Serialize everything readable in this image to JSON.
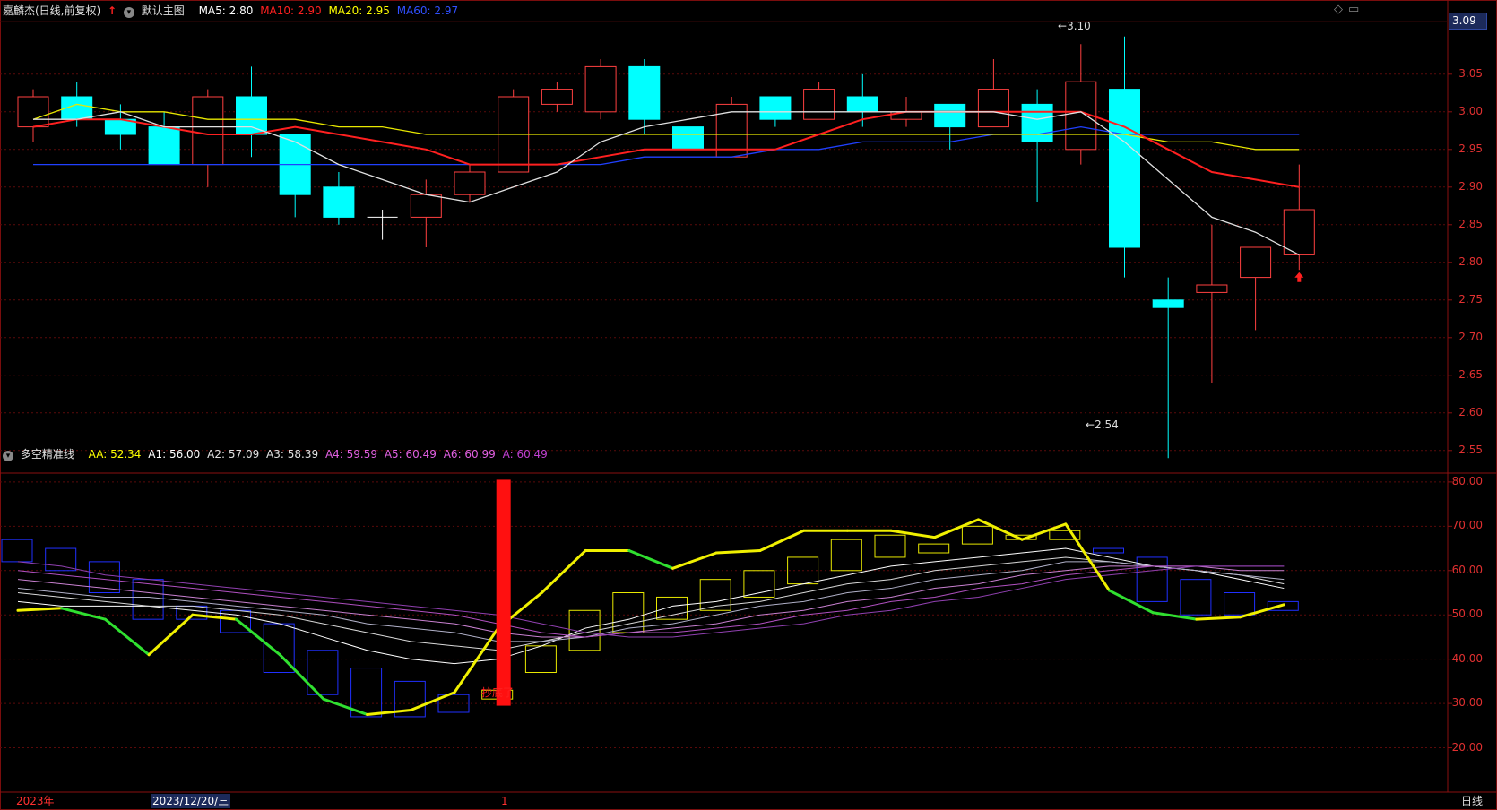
{
  "header_main": {
    "stock": "嘉麟杰(日线,前复权)",
    "up_arrow_icon": "up-arrow-icon",
    "dropdown_icon": "chevron-down-icon",
    "template": "默认主图",
    "ma5": "MA5: 2.80",
    "ma10": "MA10: 2.90",
    "ma20": "MA20: 2.95",
    "ma60": "MA60: 2.97",
    "colors": {
      "ma5": "#ffffff",
      "ma10": "#ff2020",
      "ma20": "#ffff00",
      "ma60": "#3050ff"
    }
  },
  "header_sub": {
    "dropdown_icon": "chevron-down-icon",
    "indicator": "多空精准线",
    "aa": "AA: 52.34",
    "a1": "A1: 56.00",
    "a2": "A2: 57.09",
    "a3": "A3: 58.39",
    "a4": "A4: 59.59",
    "a5": "A5: 60.49",
    "a6": "A6: 60.99",
    "a": "A: 60.49"
  },
  "price_axis": [
    "3.05",
    "3.00",
    "2.95",
    "2.90",
    "2.85",
    "2.80",
    "2.75",
    "2.70",
    "2.65",
    "2.60",
    "2.55"
  ],
  "current_price": "3.09",
  "high_label": "3.10",
  "low_label": "2.54",
  "indicator_axis": [
    "80.00",
    "70.00",
    "60.00",
    "50.00",
    "40.00",
    "30.00",
    "20.00"
  ],
  "signal_label": "抄底了",
  "bottom": {
    "year": "2023年",
    "date": "2023/12/20/三",
    "month_mark": "1",
    "period": "日线"
  },
  "corner_icons": [
    "diamond-icon",
    "window-icon"
  ],
  "chart_data": {
    "type": "candlestick",
    "price_range": [
      2.52,
      3.12
    ],
    "candles": [
      {
        "o": 2.98,
        "c": 3.02,
        "h": 3.03,
        "l": 2.96
      },
      {
        "o": 3.02,
        "c": 2.99,
        "h": 3.04,
        "l": 2.98
      },
      {
        "o": 2.99,
        "c": 2.97,
        "h": 3.01,
        "l": 2.95
      },
      {
        "o": 2.98,
        "c": 2.93,
        "h": 3.0,
        "l": 2.93
      },
      {
        "o": 2.93,
        "c": 3.02,
        "h": 3.03,
        "l": 2.9
      },
      {
        "o": 3.02,
        "c": 2.97,
        "h": 3.06,
        "l": 2.94
      },
      {
        "o": 2.97,
        "c": 2.89,
        "h": 2.97,
        "l": 2.86
      },
      {
        "o": 2.9,
        "c": 2.86,
        "h": 2.92,
        "l": 2.85
      },
      {
        "o": 2.86,
        "c": 2.86,
        "h": 2.87,
        "l": 2.83
      },
      {
        "o": 2.86,
        "c": 2.89,
        "h": 2.91,
        "l": 2.82
      },
      {
        "o": 2.89,
        "c": 2.92,
        "h": 2.93,
        "l": 2.88
      },
      {
        "o": 2.92,
        "c": 3.02,
        "h": 3.03,
        "l": 2.92
      },
      {
        "o": 3.01,
        "c": 3.03,
        "h": 3.04,
        "l": 3.0
      },
      {
        "o": 3.0,
        "c": 3.06,
        "h": 3.07,
        "l": 2.99
      },
      {
        "o": 3.06,
        "c": 2.99,
        "h": 3.07,
        "l": 2.97
      },
      {
        "o": 2.98,
        "c": 2.95,
        "h": 3.02,
        "l": 2.94
      },
      {
        "o": 2.94,
        "c": 3.01,
        "h": 3.02,
        "l": 2.94
      },
      {
        "o": 3.02,
        "c": 2.99,
        "h": 3.02,
        "l": 2.98
      },
      {
        "o": 2.99,
        "c": 3.03,
        "h": 3.04,
        "l": 2.99
      },
      {
        "o": 3.02,
        "c": 3.0,
        "h": 3.05,
        "l": 2.98
      },
      {
        "o": 2.99,
        "c": 3.0,
        "h": 3.02,
        "l": 2.98
      },
      {
        "o": 3.01,
        "c": 2.98,
        "h": 3.01,
        "l": 2.95
      },
      {
        "o": 2.98,
        "c": 3.03,
        "h": 3.07,
        "l": 2.98
      },
      {
        "o": 3.01,
        "c": 2.96,
        "h": 3.03,
        "l": 2.88
      },
      {
        "o": 2.95,
        "c": 3.04,
        "h": 3.09,
        "l": 2.93
      },
      {
        "o": 3.03,
        "c": 2.82,
        "h": 3.1,
        "l": 2.78
      },
      {
        "o": 2.75,
        "c": 2.74,
        "h": 2.78,
        "l": 2.54
      },
      {
        "o": 2.76,
        "c": 2.77,
        "h": 2.85,
        "l": 2.64
      },
      {
        "o": 2.78,
        "c": 2.82,
        "h": 2.82,
        "l": 2.71
      },
      {
        "o": 2.81,
        "c": 2.87,
        "h": 2.93,
        "l": 2.79
      }
    ],
    "ma5": [
      2.99,
      2.99,
      3.0,
      2.98,
      2.98,
      2.98,
      2.96,
      2.93,
      2.91,
      2.89,
      2.88,
      2.9,
      2.92,
      2.96,
      2.98,
      2.99,
      3.0,
      3.0,
      3.0,
      3.0,
      3.0,
      3.0,
      3.0,
      2.99,
      3.0,
      2.96,
      2.91,
      2.86,
      2.84,
      2.81
    ],
    "ma10": [
      2.98,
      2.99,
      2.99,
      2.98,
      2.97,
      2.97,
      2.98,
      2.97,
      2.96,
      2.95,
      2.93,
      2.93,
      2.93,
      2.94,
      2.95,
      2.95,
      2.95,
      2.95,
      2.97,
      2.99,
      3.0,
      3.0,
      3.0,
      3.0,
      3.0,
      2.98,
      2.95,
      2.92,
      2.91,
      2.9
    ],
    "ma20": [
      2.99,
      3.01,
      3.0,
      3.0,
      2.99,
      2.99,
      2.99,
      2.98,
      2.98,
      2.97,
      2.97,
      2.97,
      2.97,
      2.97,
      2.97,
      2.97,
      2.97,
      2.97,
      2.97,
      2.97,
      2.97,
      2.97,
      2.97,
      2.97,
      2.97,
      2.97,
      2.96,
      2.96,
      2.95,
      2.95
    ],
    "ma60": [
      2.93,
      2.93,
      2.93,
      2.93,
      2.93,
      2.93,
      2.93,
      2.93,
      2.93,
      2.93,
      2.93,
      2.93,
      2.93,
      2.93,
      2.94,
      2.94,
      2.94,
      2.95,
      2.95,
      2.96,
      2.96,
      2.96,
      2.97,
      2.97,
      2.98,
      2.97,
      2.97,
      2.97,
      2.97,
      2.97
    ],
    "indicator": {
      "range": [
        10,
        82
      ],
      "aa": [
        51,
        51.5,
        49,
        41,
        50,
        49,
        41,
        31,
        27.5,
        28.5,
        32.5,
        47,
        55,
        64.5,
        64.5,
        60.5,
        64,
        64.5,
        69,
        69,
        69,
        67.5,
        71.5,
        67,
        70.5,
        55.5,
        50.5,
        49,
        49.5,
        52.3
      ],
      "aa_colors": [
        "yellow",
        "yellow",
        "green",
        "green",
        "yellow",
        "yellow",
        "green",
        "green",
        "green",
        "yellow",
        "yellow",
        "yellow",
        "yellow",
        "yellow",
        "yellow",
        "green",
        "yellow",
        "yellow",
        "yellow",
        "yellow",
        "yellow",
        "yellow",
        "yellow",
        "yellow",
        "yellow",
        "yellow",
        "green",
        "green",
        "yellow",
        "yellow"
      ],
      "boxes": [
        {
          "lo": 62,
          "hi": 67,
          "c": "blue"
        },
        {
          "lo": 60,
          "hi": 65,
          "c": "blue"
        },
        {
          "lo": 55,
          "hi": 62,
          "c": "blue"
        },
        {
          "lo": 49,
          "hi": 58,
          "c": "blue"
        },
        {
          "lo": 49,
          "hi": 52,
          "c": "blue"
        },
        {
          "lo": 46,
          "hi": 51,
          "c": "blue"
        },
        {
          "lo": 37,
          "hi": 48,
          "c": "blue"
        },
        {
          "lo": 32,
          "hi": 42,
          "c": "blue"
        },
        {
          "lo": 27,
          "hi": 38,
          "c": "blue"
        },
        {
          "lo": 27,
          "hi": 35,
          "c": "blue"
        },
        {
          "lo": 28,
          "hi": 32,
          "c": "blue"
        },
        {
          "lo": 31,
          "hi": 33,
          "c": "yellow"
        },
        {
          "lo": 37,
          "hi": 43,
          "c": "yellow"
        },
        {
          "lo": 42,
          "hi": 51,
          "c": "yellow"
        },
        {
          "lo": 46,
          "hi": 55,
          "c": "yellow"
        },
        {
          "lo": 49,
          "hi": 54,
          "c": "yellow"
        },
        {
          "lo": 51,
          "hi": 58,
          "c": "yellow"
        },
        {
          "lo": 54,
          "hi": 60,
          "c": "yellow"
        },
        {
          "lo": 57,
          "hi": 63,
          "c": "yellow"
        },
        {
          "lo": 60,
          "hi": 67,
          "c": "yellow"
        },
        {
          "lo": 63,
          "hi": 68,
          "c": "yellow"
        },
        {
          "lo": 64,
          "hi": 66,
          "c": "yellow"
        },
        {
          "lo": 66,
          "hi": 70,
          "c": "yellow"
        },
        {
          "lo": 67,
          "hi": 68,
          "c": "yellow"
        },
        {
          "lo": 67,
          "hi": 69,
          "c": "yellow"
        },
        {
          "lo": 64,
          "hi": 65,
          "c": "blue"
        },
        {
          "lo": 53,
          "hi": 63,
          "c": "blue"
        },
        {
          "lo": 50,
          "hi": 58,
          "c": "blue"
        },
        {
          "lo": 50,
          "hi": 55,
          "c": "blue"
        },
        {
          "lo": 51,
          "hi": 53,
          "c": "blue"
        }
      ],
      "lines": [
        {
          "c": "#ffffff",
          "v": [
            53,
            52,
            52,
            52,
            51,
            50,
            48,
            45,
            42,
            40,
            39,
            40,
            43,
            47,
            49,
            52,
            53,
            55,
            57,
            59,
            61,
            62,
            63,
            64,
            65,
            63,
            61,
            60,
            58,
            56
          ]
        },
        {
          "c": "#d8d8d8",
          "v": [
            55,
            54,
            53,
            52,
            52,
            51,
            50,
            48,
            46,
            44,
            43,
            42,
            44,
            46,
            48,
            50,
            52,
            53,
            55,
            57,
            58,
            60,
            61,
            62,
            63,
            62,
            61,
            60,
            59,
            57
          ]
        },
        {
          "c": "#b0b0c8",
          "v": [
            56,
            55,
            54,
            54,
            53,
            52,
            51,
            50,
            48,
            47,
            46,
            44,
            44,
            45,
            47,
            48,
            50,
            52,
            53,
            55,
            56,
            58,
            59,
            60,
            62,
            62,
            61,
            60,
            59,
            58
          ]
        },
        {
          "c": "#c880d0",
          "v": [
            58,
            57,
            56,
            55,
            54,
            53,
            52,
            51,
            50,
            49,
            48,
            46,
            45,
            45,
            46,
            47,
            48,
            50,
            51,
            53,
            54,
            56,
            57,
            59,
            60,
            61,
            61,
            61,
            60,
            60
          ]
        },
        {
          "c": "#b050c0",
          "v": [
            60,
            59,
            58,
            57,
            56,
            55,
            54,
            53,
            52,
            51,
            50,
            48,
            46,
            45,
            46,
            46,
            47,
            48,
            50,
            51,
            53,
            54,
            56,
            57,
            59,
            60,
            61,
            61,
            61,
            61
          ]
        },
        {
          "c": "#9040b0",
          "v": [
            62,
            61,
            59,
            58,
            57,
            56,
            55,
            54,
            53,
            52,
            51,
            50,
            48,
            46,
            45,
            45,
            46,
            47,
            48,
            50,
            51,
            53,
            54,
            56,
            58,
            59,
            60,
            61,
            61,
            61
          ]
        }
      ],
      "signal_index": 11
    }
  }
}
